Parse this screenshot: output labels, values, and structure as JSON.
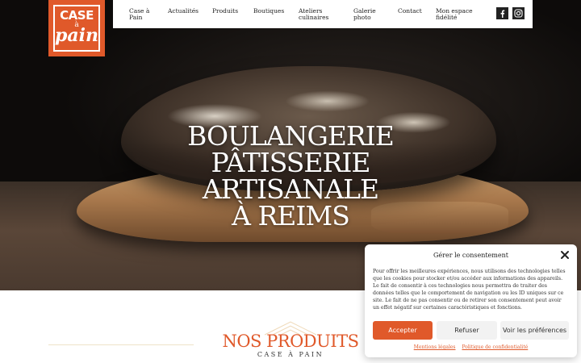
{
  "logo": {
    "line1": "CASE",
    "line2": "à",
    "line3": "pain"
  },
  "nav": {
    "items": [
      {
        "id": "case-a-pain",
        "lines": [
          "Case à",
          "Pain"
        ]
      },
      {
        "id": "actualites",
        "lines": [
          "Actualités"
        ]
      },
      {
        "id": "produits",
        "lines": [
          "Produits"
        ]
      },
      {
        "id": "boutiques",
        "lines": [
          "Boutiques"
        ]
      },
      {
        "id": "ateliers",
        "lines": [
          "Ateliers",
          "culinaires"
        ]
      },
      {
        "id": "galerie",
        "lines": [
          "Galerie",
          "photo"
        ]
      },
      {
        "id": "contact",
        "lines": [
          "Contact"
        ]
      },
      {
        "id": "fidelite",
        "lines": [
          "Mon espace",
          "fidélité"
        ]
      }
    ],
    "social": [
      {
        "icon": "facebook-icon"
      },
      {
        "icon": "instagram-icon"
      }
    ]
  },
  "hero": {
    "lines": [
      "BOULANGERIE",
      "PÂTISSERIE",
      "ARTISANALE",
      "À REIMS"
    ]
  },
  "produits": {
    "title": "NOS PRODUITS",
    "subtitle": "CASE À PAIN"
  },
  "consent": {
    "title": "Gérer le consentement",
    "text": "Pour offrir les meilleures expériences, nous utilisons des technologies telles que les cookies pour stocker et/ou accéder aux informations des appareils. Le fait de consentir à ces technologies nous permettra de traiter des données telles que le comportement de navigation ou les ID uniques sur ce site. Le fait de ne pas consentir ou de retirer son consentement peut avoir un effet négatif sur certaines caractéristiques et fonctions.",
    "accept": "Accepter",
    "refuse": "Refuser",
    "prefs": "Voir les préférences",
    "link_legal": "Mentions légales",
    "link_privacy": "Politique de confidentialité"
  },
  "colors": {
    "brand": "#e0592a",
    "dark": "#0d0b0a"
  }
}
